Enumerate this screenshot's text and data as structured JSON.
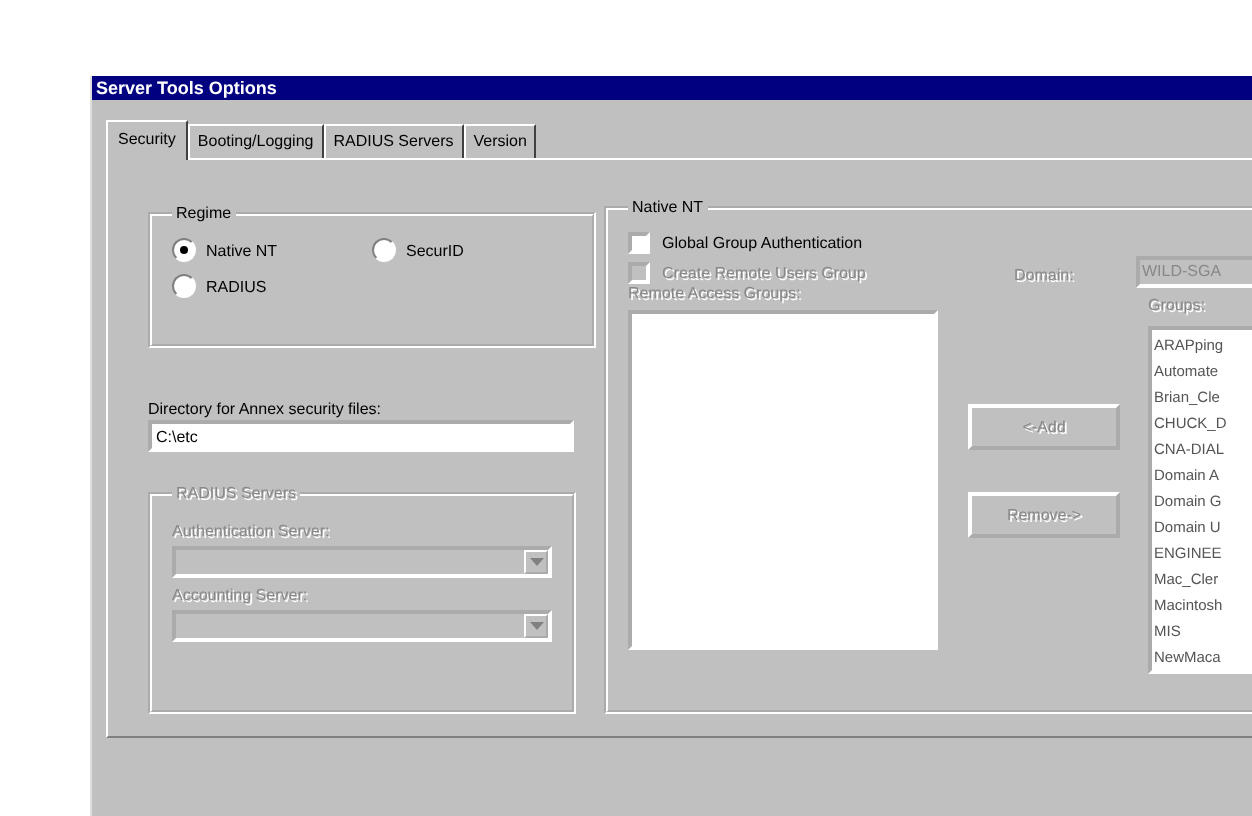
{
  "window": {
    "title": "Server Tools Options"
  },
  "tabs": [
    {
      "label": "Security",
      "selected": true
    },
    {
      "label": "Booting/Logging",
      "selected": false
    },
    {
      "label": "RADIUS Servers",
      "selected": false
    },
    {
      "label": "Version",
      "selected": false
    }
  ],
  "regime": {
    "title": "Regime",
    "options": [
      {
        "label": "Native NT",
        "selected": true
      },
      {
        "label": "SecurID",
        "selected": false
      },
      {
        "label": "RADIUS",
        "selected": false
      }
    ]
  },
  "directory": {
    "label": "Directory for Annex security files:",
    "value": "C:\\etc"
  },
  "radius_servers": {
    "title": "RADIUS Servers",
    "disabled": true,
    "fields": [
      {
        "label": "Authentication Server:"
      },
      {
        "label": "Accounting Server:"
      }
    ]
  },
  "native_nt": {
    "title": "Native NT",
    "checkboxes": [
      {
        "label": "Global Group Authentication",
        "checked": false,
        "disabled": false
      },
      {
        "label": "Create Remote Users Group",
        "checked": false,
        "disabled": true
      }
    ],
    "remote_groups": {
      "label": "Remote Access Groups:",
      "disabled": true
    },
    "add_button": {
      "label": "<-Add",
      "disabled": true
    },
    "remove_button": {
      "label": "Remove->",
      "disabled": true
    },
    "domain": {
      "label": "Domain:",
      "value": "WILD-SGA",
      "disabled": true
    },
    "groups": {
      "label": "Groups:",
      "disabled": true,
      "items": [
        "ARAPping",
        "Automate",
        "Brian_Cle",
        "CHUCK_D",
        "CNA-DIAL",
        "Domain A",
        "Domain G",
        "Domain U",
        "ENGINEE",
        "Mac_Cler",
        "Macintosh",
        "MIS",
        "NewMaca"
      ]
    }
  }
}
